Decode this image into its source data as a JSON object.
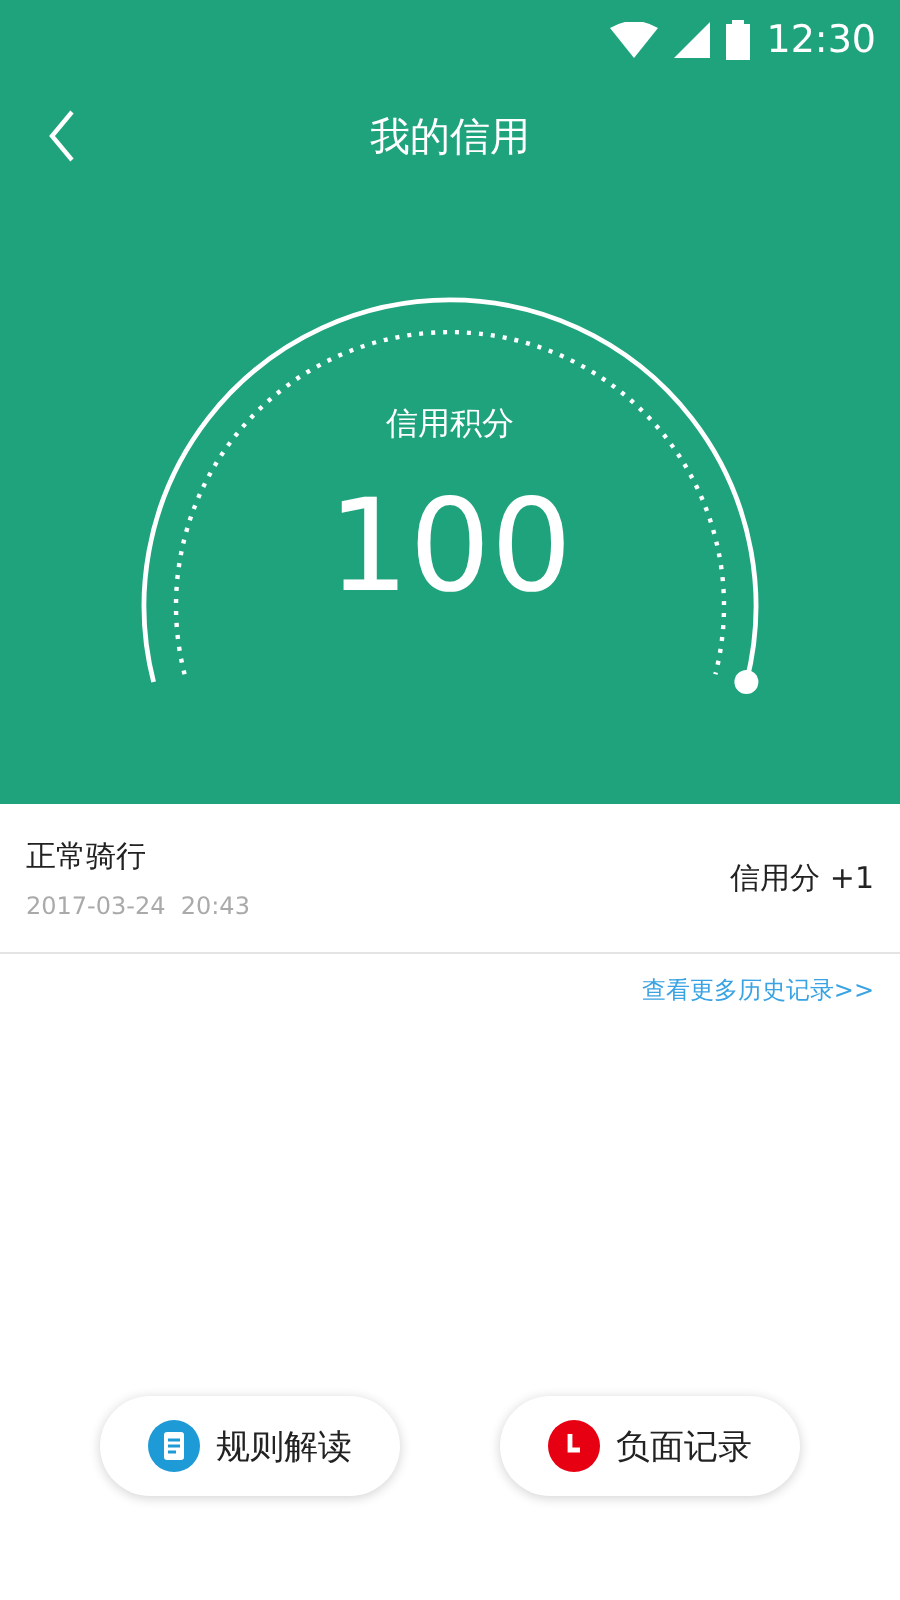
{
  "status_bar": {
    "time": "12:30"
  },
  "header": {
    "title": "我的信用"
  },
  "gauge": {
    "label": "信用积分",
    "score": "100"
  },
  "records": [
    {
      "title": "正常骑行",
      "time": "2017-03-24  20:43",
      "change": "信用分 +1"
    }
  ],
  "more_link": "查看更多历史记录>>",
  "buttons": [
    {
      "kind": "rules",
      "label": "规则解读",
      "color": "#1e9ad6"
    },
    {
      "kind": "negative",
      "label": "负面记录",
      "color": "#e60012"
    }
  ]
}
